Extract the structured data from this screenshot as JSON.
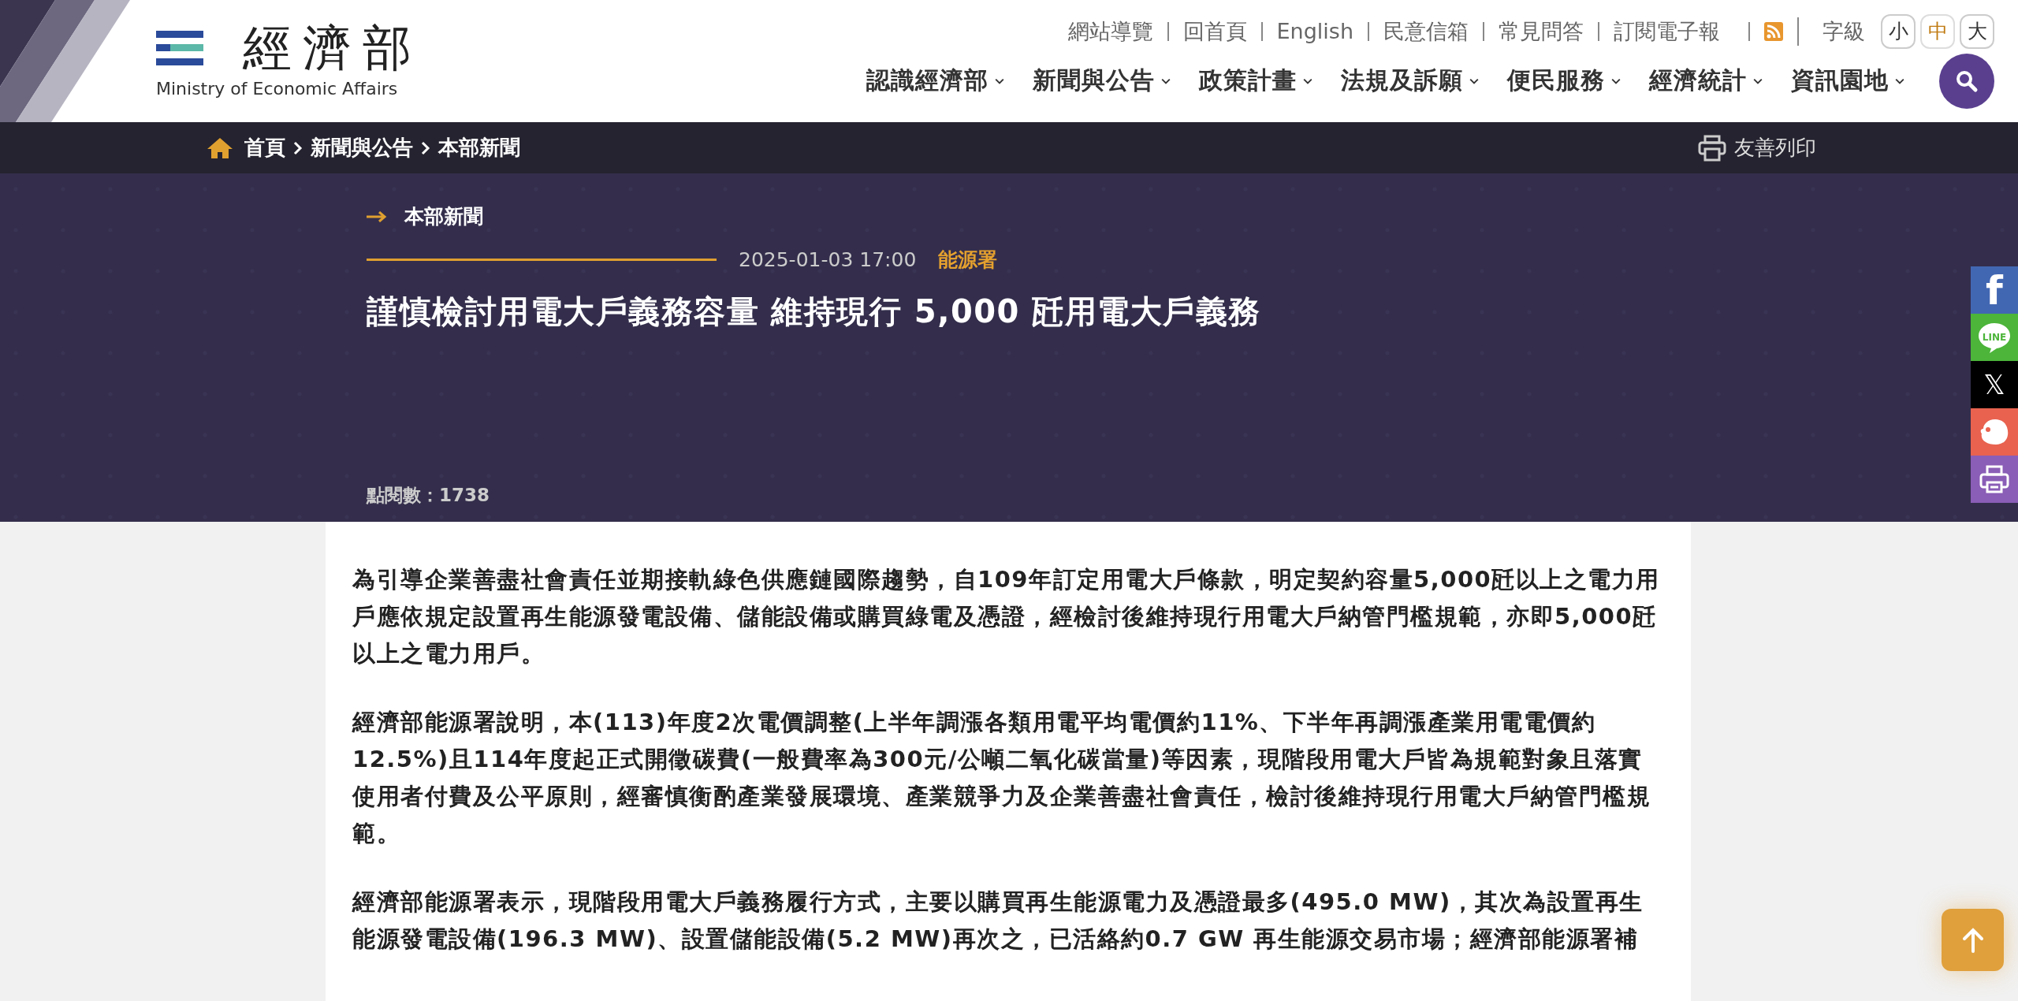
{
  "header": {
    "logo_text": "經濟部",
    "logo_subtitle": "Ministry of Economic Affairs",
    "top_links": [
      "網站導覽",
      "回首頁",
      "English",
      "民意信箱",
      "常見問答",
      "訂閱電子報"
    ],
    "font_size_label": "字級",
    "font_sizes": [
      {
        "label": "小",
        "selected": false
      },
      {
        "label": "中",
        "selected": true
      },
      {
        "label": "大",
        "selected": false
      }
    ],
    "nav": [
      "認識經濟部",
      "新聞與公告",
      "政策計畫",
      "法規及訴願",
      "便民服務",
      "經濟統計",
      "資訊園地"
    ]
  },
  "breadcrumb": [
    "首頁",
    "新聞與公告",
    "本部新聞"
  ],
  "print_label": "友善列印",
  "article": {
    "category": "本部新聞",
    "date": "2025-01-03 17:00",
    "agency": "能源署",
    "title": "謹慎檢討用電大戶義務容量 維持現行 5,000 瓩用電大戶義務",
    "views": "點閱數：1738",
    "paragraphs": [
      "為引導企業善盡社會責任並期接軌綠色供應鏈國際趨勢，自109年訂定用電大戶條款，明定契約容量5,000瓩以上之電力用戶應依規定設置再生能源發電設備、儲能設備或購買綠電及憑證，經檢討後維持現行用電大戶納管門檻規範，亦即5,000瓩以上之電力用戶。",
      "經濟部能源署說明，本(113)年度2次電價調整(上半年調漲各類用電平均電價約11%、下半年再調漲產業用電電價約12.5%)且114年度起正式開徵碳費(一般費率為300元/公噸二氧化碳當量)等因素，現階段用電大戶皆為規範對象且落實使用者付費及公平原則，經審慎衡酌產業發展環境、產業競爭力及企業善盡社會責任，檢討後維持現行用電大戶納管門檻規範。",
      "經濟部能源署表示，現階段用電大戶義務履行方式，主要以購買再生能源電力及憑證最多(495.0 MW)，其次為設置再生能源發電設備(196.3 MW)、設置儲能設備(5.2 MW)再次之，已活絡約0.7 GW 再生能源交易市場；經濟部能源署補"
    ]
  },
  "share": [
    {
      "kind": "facebook",
      "glyph": "f"
    },
    {
      "kind": "line",
      "glyph": "LINE"
    },
    {
      "kind": "x",
      "glyph": "𝕏"
    },
    {
      "kind": "plurk"
    },
    {
      "kind": "print"
    }
  ]
}
